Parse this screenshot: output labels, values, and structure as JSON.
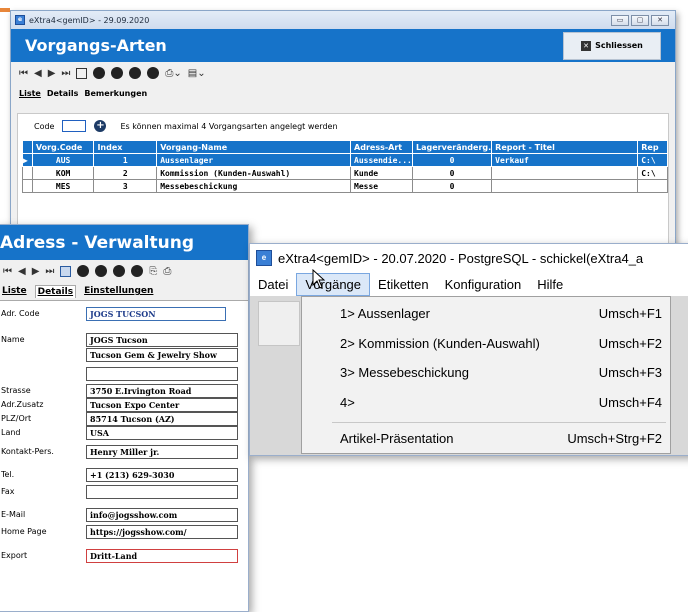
{
  "win1": {
    "titlebar": "eXtra4<gemID> - 29.09.2020",
    "header_title": "Vorgangs-Arten",
    "close_label": "Schliessen",
    "tabs": [
      "Liste",
      "Details",
      "Bemerkungen"
    ],
    "code_label": "Code",
    "info_text": "Es können maximal 4 Vorgangsarten angelegt werden",
    "columns": [
      "Vorg.Code",
      "Index",
      "Vorgang-Name",
      "Adress-Art",
      "Lagerveränderg.",
      "Report - Titel",
      "Rep"
    ],
    "rows": [
      [
        "AUS",
        "1",
        "Aussenlager",
        "Aussendie...",
        "0",
        "Verkauf",
        "C:\\"
      ],
      [
        "KOM",
        "2",
        "Kommission (Kunden-Auswahl)",
        "Kunde",
        "0",
        "",
        "C:\\"
      ],
      [
        "MES",
        "3",
        "Messebeschickung",
        "Messe",
        "0",
        "",
        ""
      ]
    ]
  },
  "win2": {
    "header_title": "Adress - Verwaltung",
    "tabs": [
      "Liste",
      "Details",
      "Einstellungen"
    ],
    "fields": {
      "adr_code": {
        "label": "Adr. Code",
        "value": "JOGS TUCSON"
      },
      "name": {
        "label": "Name",
        "value1": "JOGS Tucson",
        "value2": "Tucson Gem & Jewelry Show",
        "value3": ""
      },
      "strasse": {
        "label": "Strasse",
        "value": "3750 E.Irvington Road"
      },
      "adrzusatz": {
        "label": "Adr.Zusatz",
        "value": "Tucson Expo Center"
      },
      "plzort": {
        "label": "PLZ/Ort",
        "value": "85714 Tucson (AZ)"
      },
      "land": {
        "label": "Land",
        "value": "USA"
      },
      "kontakt": {
        "label": "Kontakt-Pers.",
        "value": "Henry Miller jr."
      },
      "tel": {
        "label": "Tel.",
        "value": "+1 (213) 629-3030"
      },
      "fax": {
        "label": "Fax",
        "value": ""
      },
      "email": {
        "label": "E-Mail",
        "value": "info@jogsshow.com"
      },
      "homepage": {
        "label": "Home Page",
        "value": "https://jogsshow.com/"
      },
      "export": {
        "label": "Export",
        "value": "Dritt-Land"
      }
    }
  },
  "win3": {
    "titlebar": "eXtra4<gemID> - 20.07.2020 - PostgreSQL - schickel(eXtra4_a",
    "menu": [
      "Datei",
      "Vorgänge",
      "Etiketten",
      "Konfiguration",
      "Hilfe"
    ],
    "dropdown": [
      {
        "label": "1> Aussenlager",
        "shortcut": "Umsch+F1"
      },
      {
        "label": "2> Kommission (Kunden-Auswahl)",
        "shortcut": "Umsch+F2"
      },
      {
        "label": "3> Messebeschickung",
        "shortcut": "Umsch+F3"
      },
      {
        "label": "4>",
        "shortcut": "Umsch+F4"
      },
      {
        "label": "Artikel-Präsentation",
        "shortcut": "Umsch+Strg+F2"
      }
    ]
  },
  "colors": {
    "accent_blue": "#1673c9",
    "corner_orange": "#e8863a"
  }
}
